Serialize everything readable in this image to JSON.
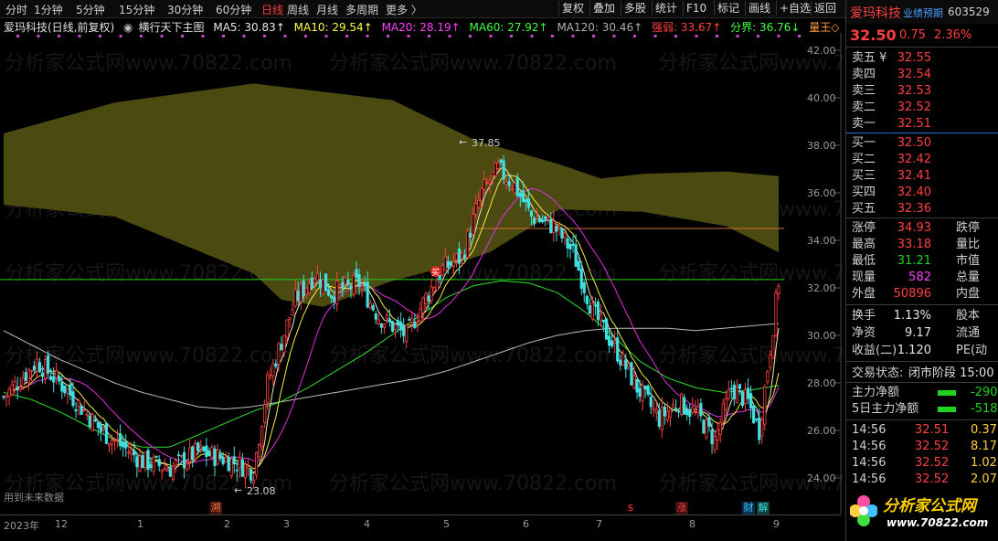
{
  "toolbar": {
    "periods": [
      "分时",
      "1分钟",
      "5分钟",
      "15分钟",
      "30分钟",
      "60分钟",
      "日线",
      "周线",
      "月线",
      "多周期",
      "更多 〉"
    ],
    "active": "日线",
    "right_buttons": [
      "复权",
      "叠加",
      "多股",
      "统计",
      "F10",
      "标记",
      "画线",
      "+自选",
      "返回"
    ]
  },
  "indicator_line": {
    "stock": "爱玛科技(日线,前复权)",
    "main_indicator": "横行天下主图",
    "ma5": "MA5: 30.83↑",
    "ma10": "MA10: 29.54↑",
    "ma20": "MA20: 28.19↑",
    "ma60": "MA60: 27.92↑",
    "ma120": "MA120: 30.46↑",
    "strong_weak": "强弱: 33.67↑",
    "boundary": "分界: 36.76↓",
    "king": "量王◇"
  },
  "colors": {
    "up": "#ff4040",
    "down": "#40e0e0",
    "ma5": "#e8e8a0",
    "ma10": "#ffff40",
    "ma20": "#ff40ff",
    "ma60": "#40ff40",
    "ma120": "#c0c0c0",
    "band": "#5a5a1a"
  },
  "chart": {
    "y_ticks": [
      "42.00",
      "40.00",
      "38.00",
      "36.00",
      "34.00",
      "32.00",
      "30.00",
      "28.00",
      "26.00",
      "24.00"
    ],
    "x_ticks": [
      "2023年",
      "12",
      "1",
      "2",
      "3",
      "4",
      "5",
      "6",
      "7",
      "8",
      "9"
    ],
    "high_label": "37.85",
    "low_label": "23.08",
    "note": "用到未来数据",
    "watermark": "分析家公式网www.70822.com",
    "markers": [
      "溯",
      "$",
      "涨",
      "财",
      "解"
    ],
    "buy_marker": "买",
    "logo_title": "分析家公式网",
    "logo_url": "www.70822.com"
  },
  "chart_data": {
    "type": "candlestick",
    "ylim": [
      23.5,
      42.5
    ],
    "price_line": 32.35,
    "lines": [
      {
        "name": "MA120",
        "values": [
          30.2,
          29.6,
          29.0,
          28.5,
          28.0,
          27.6,
          27.3,
          27.0,
          26.9,
          27.0,
          27.2,
          27.4,
          27.6,
          27.8,
          28.0,
          28.2,
          28.5,
          28.9,
          29.3,
          29.7,
          30.0,
          30.2,
          30.3,
          30.3,
          30.3,
          30.2,
          30.3,
          30.4,
          30.5
        ]
      },
      {
        "name": "MA60",
        "values": [
          27.6,
          27.3,
          26.8,
          26.2,
          25.6,
          25.3,
          25.3,
          25.8,
          26.3,
          26.8,
          27.2,
          27.8,
          28.5,
          29.2,
          30.0,
          30.8,
          31.6,
          32.1,
          32.3,
          32.2,
          31.8,
          31.0,
          30.0,
          28.9,
          28.2,
          27.8,
          27.6,
          27.7,
          27.9
        ]
      }
    ],
    "candles_summary": {
      "start_price": 27.5,
      "first_low": 24.3,
      "low": 23.08,
      "high": 37.85,
      "last_close": 32.5
    }
  },
  "panel": {
    "name": "爱玛科技",
    "tag": "业绩预期",
    "code": "603529",
    "price": "32.50",
    "change": "0.75",
    "pct": "2.36%",
    "asks": [
      {
        "label": "卖五 ¥",
        "price": "32.55"
      },
      {
        "label": "卖四",
        "price": "32.54"
      },
      {
        "label": "卖三",
        "price": "32.53"
      },
      {
        "label": "卖二",
        "price": "32.52"
      },
      {
        "label": "卖一",
        "price": "32.51"
      }
    ],
    "bids": [
      {
        "label": "买一",
        "price": "32.50"
      },
      {
        "label": "买二",
        "price": "32.42"
      },
      {
        "label": "买三",
        "price": "32.41"
      },
      {
        "label": "买四",
        "price": "32.40"
      },
      {
        "label": "买五",
        "price": "32.36"
      }
    ],
    "stats": [
      {
        "label": "涨停",
        "value": "34.93",
        "r": "跌停",
        "vc": "red"
      },
      {
        "label": "最高",
        "value": "33.18",
        "r": "量比",
        "vc": "red"
      },
      {
        "label": "最低",
        "value": "31.21",
        "r": "市值",
        "vc": "grn"
      },
      {
        "label": "现量",
        "value": "582",
        "r": "总量",
        "vc": "mag"
      },
      {
        "label": "外盘",
        "value": "50896",
        "r": "内盘",
        "vc": "red"
      }
    ],
    "stats2": [
      {
        "label": "换手",
        "value": "1.13%",
        "r": "股本"
      },
      {
        "label": "净资",
        "value": "9.17",
        "r": "流通"
      },
      {
        "label": "收益(二)",
        "value": "1.120",
        "r": "PE(动"
      }
    ],
    "trade_state_label": "交易状态:",
    "trade_state": "闭市阶段 15:00",
    "flows": [
      {
        "label": "主力净额",
        "value": "-290"
      },
      {
        "label": "5日主力净额",
        "value": "-518"
      }
    ],
    "ticks": [
      {
        "time": "14:56",
        "price": "32.51",
        "vol": "0.37"
      },
      {
        "time": "14:56",
        "price": "32.52",
        "vol": "8.17"
      },
      {
        "time": "14:56",
        "price": "32.52",
        "vol": "1.02"
      },
      {
        "time": "14:56",
        "price": "32.52",
        "vol": "2.07"
      }
    ]
  }
}
